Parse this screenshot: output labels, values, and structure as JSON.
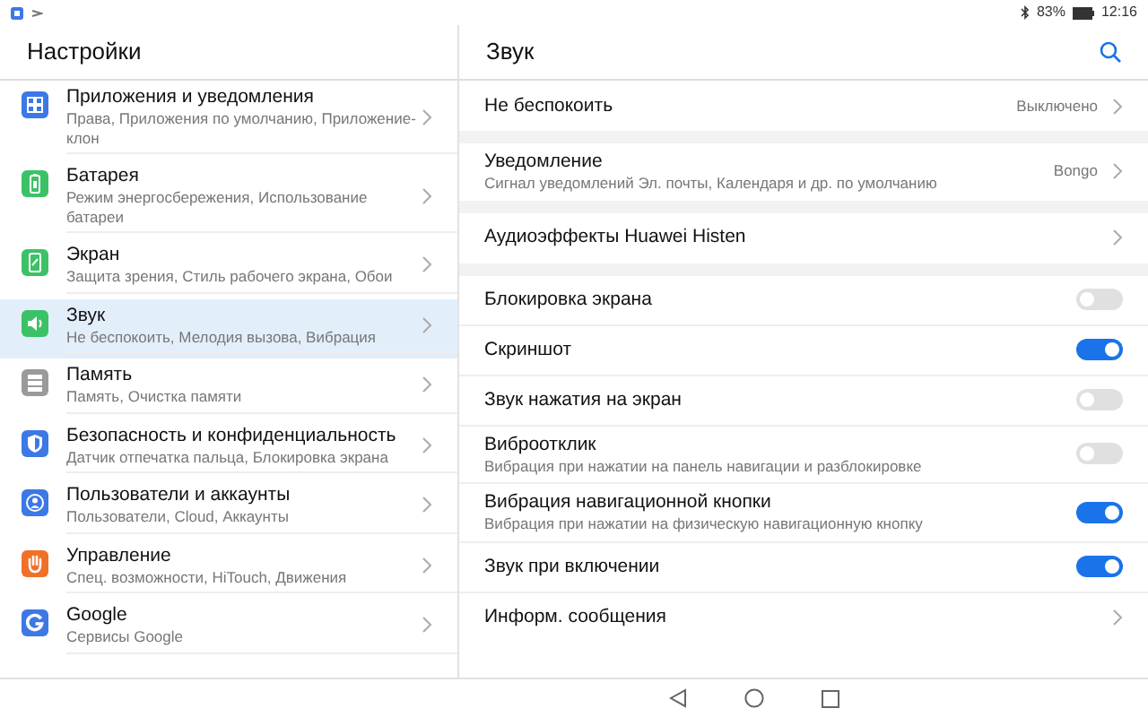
{
  "status_bar": {
    "battery": "83%",
    "time": "12:16"
  },
  "settings": {
    "title": "Настройки",
    "items": [
      {
        "kind": "apps",
        "color": "#3c78e6",
        "title": "Приложения и уведомления",
        "subtitle": "Права, Приложения по умолчанию, Приложение-клон",
        "selected": false
      },
      {
        "kind": "battery",
        "color": "#3cc266",
        "title": "Батарея",
        "subtitle": "Режим энергосбережения, Использование батареи",
        "selected": false
      },
      {
        "kind": "display",
        "color": "#3cc266",
        "title": "Экран",
        "subtitle": "Защита зрения, Стиль рабочего экрана, Обои",
        "selected": false
      },
      {
        "kind": "sound",
        "color": "#3cc266",
        "title": "Звук",
        "subtitle": "Не беспокоить, Мелодия вызова, Вибрация",
        "selected": true
      },
      {
        "kind": "storage",
        "color": "#9a9a9a",
        "title": "Память",
        "subtitle": "Память, Очистка памяти",
        "selected": false
      },
      {
        "kind": "security",
        "color": "#3c78e6",
        "title": "Безопасность и конфиденциальность",
        "subtitle": "Датчик отпечатка пальца, Блокировка экрана",
        "selected": false
      },
      {
        "kind": "users",
        "color": "#3c78e6",
        "title": "Пользователи и аккаунты",
        "subtitle": "Пользователи, Cloud, Аккаунты",
        "selected": false
      },
      {
        "kind": "gesture",
        "color": "#f07028",
        "title": "Управление",
        "subtitle": "Спец. возможности, HiTouch, Движения",
        "selected": false
      },
      {
        "kind": "google",
        "color": "#3c78e6",
        "title": "Google",
        "subtitle": "Сервисы Google",
        "selected": false
      }
    ]
  },
  "sound": {
    "title": "Звук",
    "sections": [
      {
        "rows": [
          {
            "kind": "link",
            "title": "Не беспокоить",
            "value": "Выключено"
          }
        ]
      },
      {
        "rows": [
          {
            "kind": "link",
            "title": "Уведомление",
            "subtitle": "Сигнал уведомлений Эл. почты, Календаря и др. по умолчанию",
            "value": "Bongo"
          }
        ]
      },
      {
        "rows": [
          {
            "kind": "link",
            "title": "Аудиоэффекты Huawei Histen"
          }
        ]
      },
      {
        "rows": [
          {
            "kind": "toggle",
            "title": "Блокировка экрана",
            "on": false
          },
          {
            "kind": "toggle",
            "title": "Скриншот",
            "on": true
          },
          {
            "kind": "toggle",
            "title": "Звук нажатия на экран",
            "on": false
          },
          {
            "kind": "toggle",
            "title": "Виброотклик",
            "subtitle": "Вибрация при нажатии на панель навигации и разблокировке",
            "on": false
          },
          {
            "kind": "toggle",
            "title": "Вибрация навигационной кнопки",
            "subtitle": "Вибрация при нажатии на физическую навигационную кнопку",
            "on": true
          },
          {
            "kind": "toggle",
            "title": "Звук при включении",
            "on": true
          },
          {
            "kind": "link",
            "title": "Информ. сообщения"
          }
        ]
      }
    ]
  }
}
